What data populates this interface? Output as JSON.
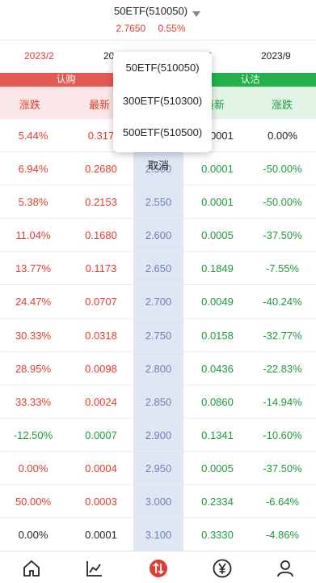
{
  "header": {
    "title": "50ETF(510050)",
    "price": "2.7650",
    "change": "0.55%"
  },
  "tabs": [
    "2023/2",
    "20",
    "/6",
    "2023/9"
  ],
  "call_label": "认购",
  "put_label": "认沽",
  "call_columns": [
    "涨跌",
    "最新"
  ],
  "put_columns": [
    "最新",
    "涨跌"
  ],
  "dropdown": {
    "items": [
      "50ETF(510050)",
      "300ETF(510300)",
      "500ETF(510500)"
    ],
    "cancel": "取消"
  },
  "rows": [
    {
      "call_change": "5.44%",
      "call_last": "0.317",
      "strike": "",
      "put_last": "0.0001",
      "put_change": "0.00%"
    },
    {
      "call_change": "6.94%",
      "call_last": "0.2680",
      "strike": "2.500",
      "put_last": "0.0001",
      "put_change": "-50.00%"
    },
    {
      "call_change": "5.38%",
      "call_last": "0.2153",
      "strike": "2.550",
      "put_last": "0.0001",
      "put_change": "-50.00%"
    },
    {
      "call_change": "11.04%",
      "call_last": "0.1680",
      "strike": "2.600",
      "put_last": "0.0005",
      "put_change": "-37.50%"
    },
    {
      "call_change": "13.77%",
      "call_last": "0.1173",
      "strike": "2.650",
      "put_last": "0.1849",
      "put_change": "-7.55%"
    },
    {
      "call_change": "24.47%",
      "call_last": "0.0707",
      "strike": "2.700",
      "put_last": "0.0049",
      "put_change": "-40.24%"
    },
    {
      "call_change": "30.33%",
      "call_last": "0.0318",
      "strike": "2.750",
      "put_last": "0.0158",
      "put_change": "-32.77%"
    },
    {
      "call_change": "28.95%",
      "call_last": "0.0098",
      "strike": "2.800",
      "put_last": "0.0436",
      "put_change": "-22.83%"
    },
    {
      "call_change": "33.33%",
      "call_last": "0.0024",
      "strike": "2.850",
      "put_last": "0.0860",
      "put_change": "-14.94%"
    },
    {
      "call_change": "-12.50%",
      "call_last": "0.0007",
      "strike": "2.900",
      "put_last": "0.1341",
      "put_change": "-10.60%"
    },
    {
      "call_change": "0.00%",
      "call_last": "0.0004",
      "strike": "2.950",
      "put_last": "0.0005",
      "put_change": "-37.50%"
    },
    {
      "call_change": "50.00%",
      "call_last": "0.0003",
      "strike": "3.000",
      "put_last": "0.2334",
      "put_change": "-6.64%"
    },
    {
      "call_change": "0.00%",
      "call_last": "0.0001",
      "strike": "3.100",
      "put_last": "0.3330",
      "put_change": "-4.86%"
    }
  ],
  "row_colors": [
    [
      "red",
      "red",
      "black",
      "black"
    ],
    [
      "red",
      "red",
      "green",
      "green"
    ],
    [
      "red",
      "red",
      "green",
      "green"
    ],
    [
      "red",
      "red",
      "green",
      "green"
    ],
    [
      "red",
      "red",
      "green",
      "green"
    ],
    [
      "red",
      "red",
      "green",
      "green"
    ],
    [
      "red",
      "red",
      "green",
      "green"
    ],
    [
      "red",
      "red",
      "green",
      "green"
    ],
    [
      "red",
      "red",
      "green",
      "green"
    ],
    [
      "green",
      "green",
      "green",
      "green"
    ],
    [
      "red",
      "red",
      "green",
      "green"
    ],
    [
      "red",
      "red",
      "green",
      "green"
    ],
    [
      "black",
      "black",
      "green",
      "green"
    ]
  ],
  "colors": {
    "up": "#e23b2f",
    "down": "#1e9a3f",
    "call_bar": "#e55a55",
    "put_bar": "#25b14a",
    "strike_bg": "#dfe7f5"
  },
  "nav": [
    "home-icon",
    "chart-icon",
    "options-icon",
    "yen-icon",
    "user-icon"
  ]
}
